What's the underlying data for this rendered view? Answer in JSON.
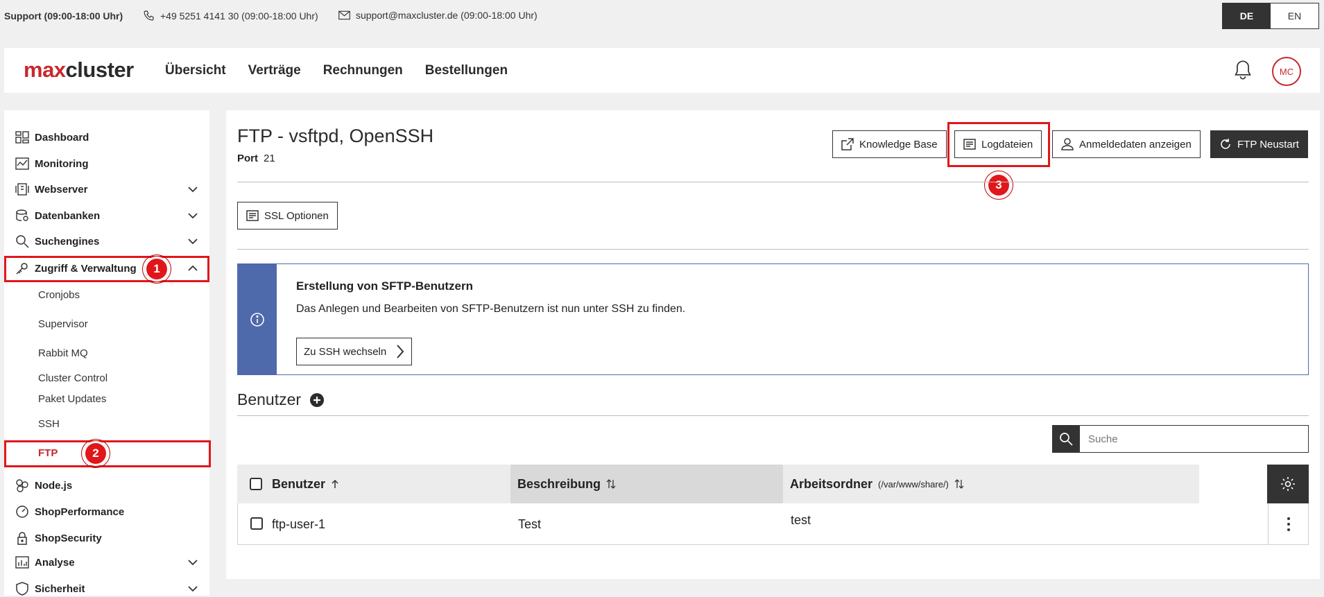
{
  "topbar": {
    "support": "Support (09:00-18:00 Uhr)",
    "phone": "+49 5251 4141 30 (09:00-18:00 Uhr)",
    "email": "support@maxcluster.de (09:00-18:00 Uhr)",
    "lang_de": "DE",
    "lang_en": "EN"
  },
  "header": {
    "logo_max": "max",
    "logo_cluster": "cluster",
    "nav": [
      "Übersicht",
      "Verträge",
      "Rechnungen",
      "Bestellungen"
    ],
    "avatar": "MC"
  },
  "sidebar": {
    "items": [
      {
        "label": "Dashboard"
      },
      {
        "label": "Monitoring"
      },
      {
        "label": "Webserver"
      },
      {
        "label": "Datenbanken"
      },
      {
        "label": "Suchengines"
      },
      {
        "label": "Zugriff & Verwaltung"
      },
      {
        "label": "Node.js"
      },
      {
        "label": "ShopPerformance"
      },
      {
        "label": "ShopSecurity"
      },
      {
        "label": "Analyse"
      },
      {
        "label": "Sicherheit"
      }
    ],
    "subitems": [
      "Cronjobs",
      "Supervisor",
      "Rabbit MQ",
      "Cluster Control",
      "Paket Updates",
      "SSH",
      "FTP"
    ]
  },
  "annotations": {
    "one": "1",
    "two": "2",
    "three": "3"
  },
  "main": {
    "title": "FTP - vsftpd, OpenSSH",
    "port_label": "Port",
    "port_value": "21",
    "buttons": {
      "knowledge": "Knowledge Base",
      "logs": "Logdateien",
      "credentials": "Anmeldedaten anzeigen",
      "restart": "FTP Neustart",
      "ssl": "SSL Optionen"
    },
    "info": {
      "heading": "Erstellung von SFTP-Benutzern",
      "text": "Das Anlegen und Bearbeiten von SFTP-Benutzern ist nun unter SSH zu finden.",
      "button": "Zu SSH wechseln"
    },
    "users_title": "Benutzer",
    "search_placeholder": "Suche",
    "table": {
      "col_user": "Benutzer",
      "col_desc": "Beschreibung",
      "col_dir": "Arbeitsordner",
      "col_dir_hint": "(/var/www/share/)",
      "rows": [
        {
          "user": "ftp-user-1",
          "desc": "Test",
          "dir": "test"
        }
      ]
    }
  },
  "colors": {
    "brand_red": "#c8282d",
    "info_blue": "#4e6aab",
    "dark": "#333333",
    "highlight": "#e0161b"
  }
}
